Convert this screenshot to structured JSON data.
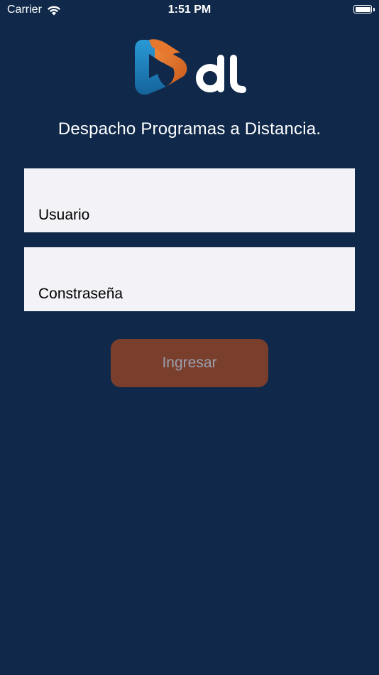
{
  "status_bar": {
    "carrier": "Carrier",
    "time": "1:51 PM",
    "wifi_icon": "wifi-icon",
    "battery_icon": "battery-icon"
  },
  "logo": {
    "icon": "play-logo-icon",
    "text": "dl",
    "colors": {
      "blue": "#1f87c4",
      "orange": "#e5772e",
      "text": "#ffffff"
    }
  },
  "subtitle": "Despacho Programas a Distancia.",
  "form": {
    "username_placeholder": "Usuario",
    "username_value": "",
    "password_placeholder": "Constraseña",
    "password_value": "",
    "submit_label": "Ingresar"
  },
  "colors": {
    "background": "#10294a",
    "field_background": "#f2f2f7",
    "button_background": "#7a3e2c",
    "button_text": "#9a9fae"
  }
}
